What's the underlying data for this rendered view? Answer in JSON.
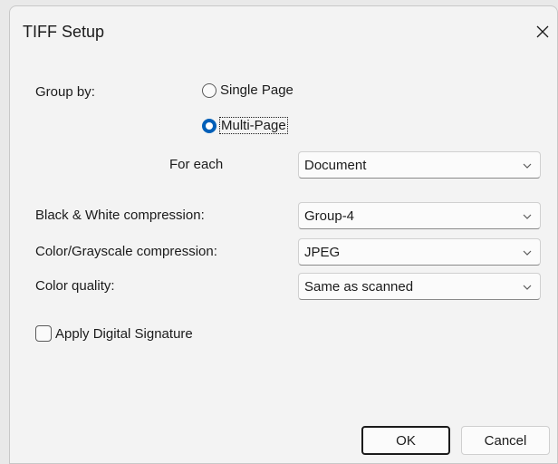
{
  "dialog": {
    "title": "TIFF Setup",
    "close_icon": "close-icon"
  },
  "group_by": {
    "label": "Group by:",
    "options": [
      {
        "label": "Single Page",
        "selected": false
      },
      {
        "label": "Multi-Page",
        "selected": true
      }
    ]
  },
  "for_each": {
    "label": "For each",
    "value": "Document"
  },
  "bw_compression": {
    "label": "Black & White compression:",
    "value": "Group-4"
  },
  "color_compression": {
    "label": "Color/Grayscale compression:",
    "value": "JPEG"
  },
  "color_quality": {
    "label": "Color quality:",
    "value": "Same as scanned"
  },
  "digital_signature": {
    "label": "Apply Digital Signature",
    "checked": false
  },
  "buttons": {
    "ok": "OK",
    "cancel": "Cancel"
  },
  "colors": {
    "accent": "#005fb8",
    "background": "#f3f3f3"
  }
}
